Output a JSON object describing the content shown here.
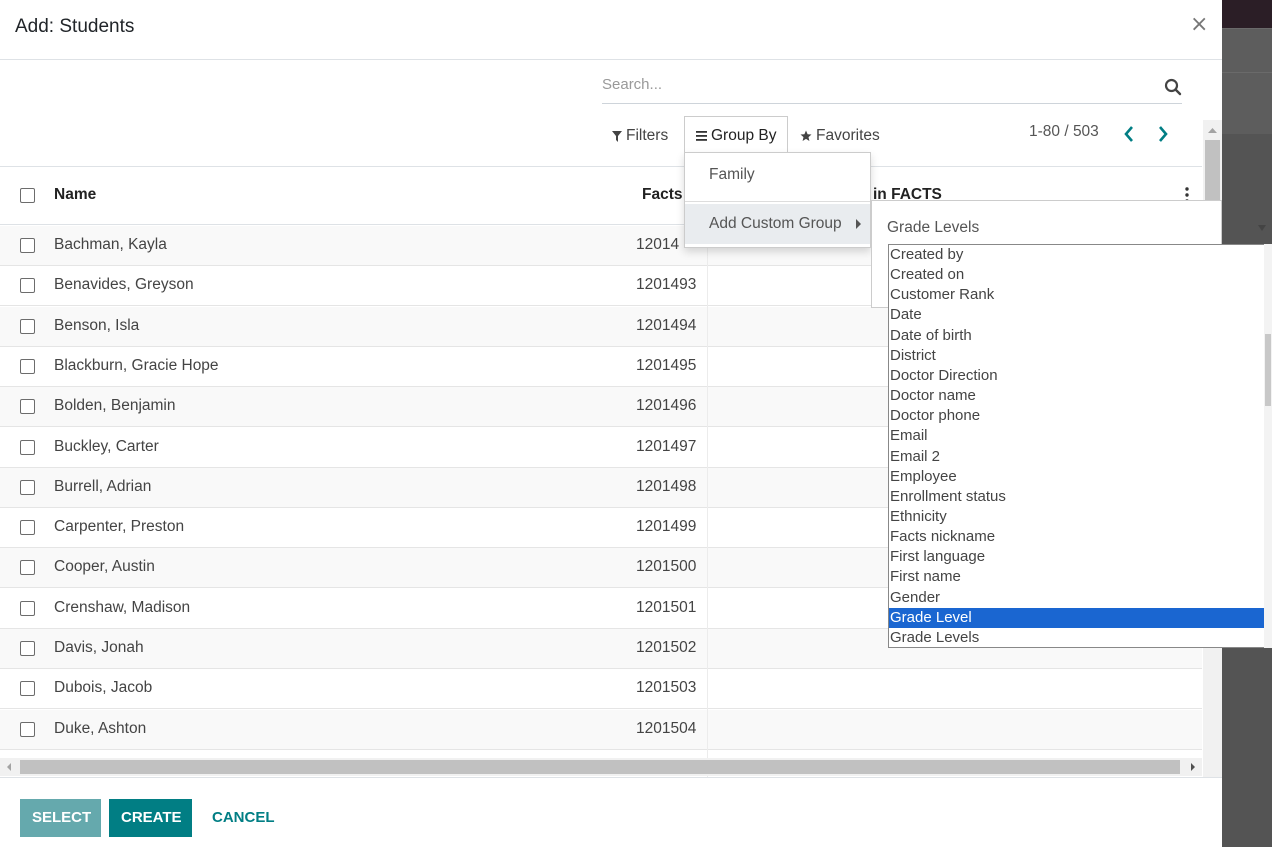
{
  "modal": {
    "title": "Add: Students",
    "close_label": "×"
  },
  "search": {
    "placeholder": "Search..."
  },
  "controls": {
    "filters": "Filters",
    "group_by": "Group By",
    "favorites": "Favorites"
  },
  "pager": {
    "range": "1-80 / 503"
  },
  "table": {
    "col_name": "Name",
    "col_facts": "Facts",
    "col_in_facts": "in FACTS",
    "rows": [
      {
        "name": "Bachman, Kayla",
        "facts": "12014"
      },
      {
        "name": "Benavides, Greyson",
        "facts": "1201493"
      },
      {
        "name": "Benson, Isla",
        "facts": "1201494"
      },
      {
        "name": "Blackburn, Gracie Hope",
        "facts": "1201495"
      },
      {
        "name": "Bolden, Benjamin",
        "facts": "1201496"
      },
      {
        "name": "Buckley, Carter",
        "facts": "1201497"
      },
      {
        "name": "Burrell, Adrian",
        "facts": "1201498"
      },
      {
        "name": "Carpenter, Preston",
        "facts": "1201499"
      },
      {
        "name": "Cooper, Austin",
        "facts": "1201500"
      },
      {
        "name": "Crenshaw, Madison",
        "facts": "1201501"
      },
      {
        "name": "Davis, Jonah",
        "facts": "1201502"
      },
      {
        "name": "Dubois, Jacob",
        "facts": "1201503"
      },
      {
        "name": "Duke, Ashton",
        "facts": "1201504"
      }
    ]
  },
  "group_by_menu": {
    "family": "Family",
    "add_custom_group": "Add Custom Group"
  },
  "custom_group_select": {
    "selected_value": "Grade Levels",
    "options": [
      "Created by",
      "Created on",
      "Customer Rank",
      "Date",
      "Date of birth",
      "District",
      "Doctor Direction",
      "Doctor name",
      "Doctor phone",
      "Email",
      "Email 2",
      "Employee",
      "Enrollment status",
      "Ethnicity",
      "Facts nickname",
      "First language",
      "First name",
      "Gender",
      "Grade Level",
      "Grade Levels"
    ],
    "highlighted": "Grade Level"
  },
  "footer": {
    "select": "Select",
    "create": "Create",
    "cancel": "Cancel"
  },
  "colors": {
    "primary": "#017e84",
    "primary_light": "#65a9ad",
    "highlight": "#1a66d1"
  }
}
